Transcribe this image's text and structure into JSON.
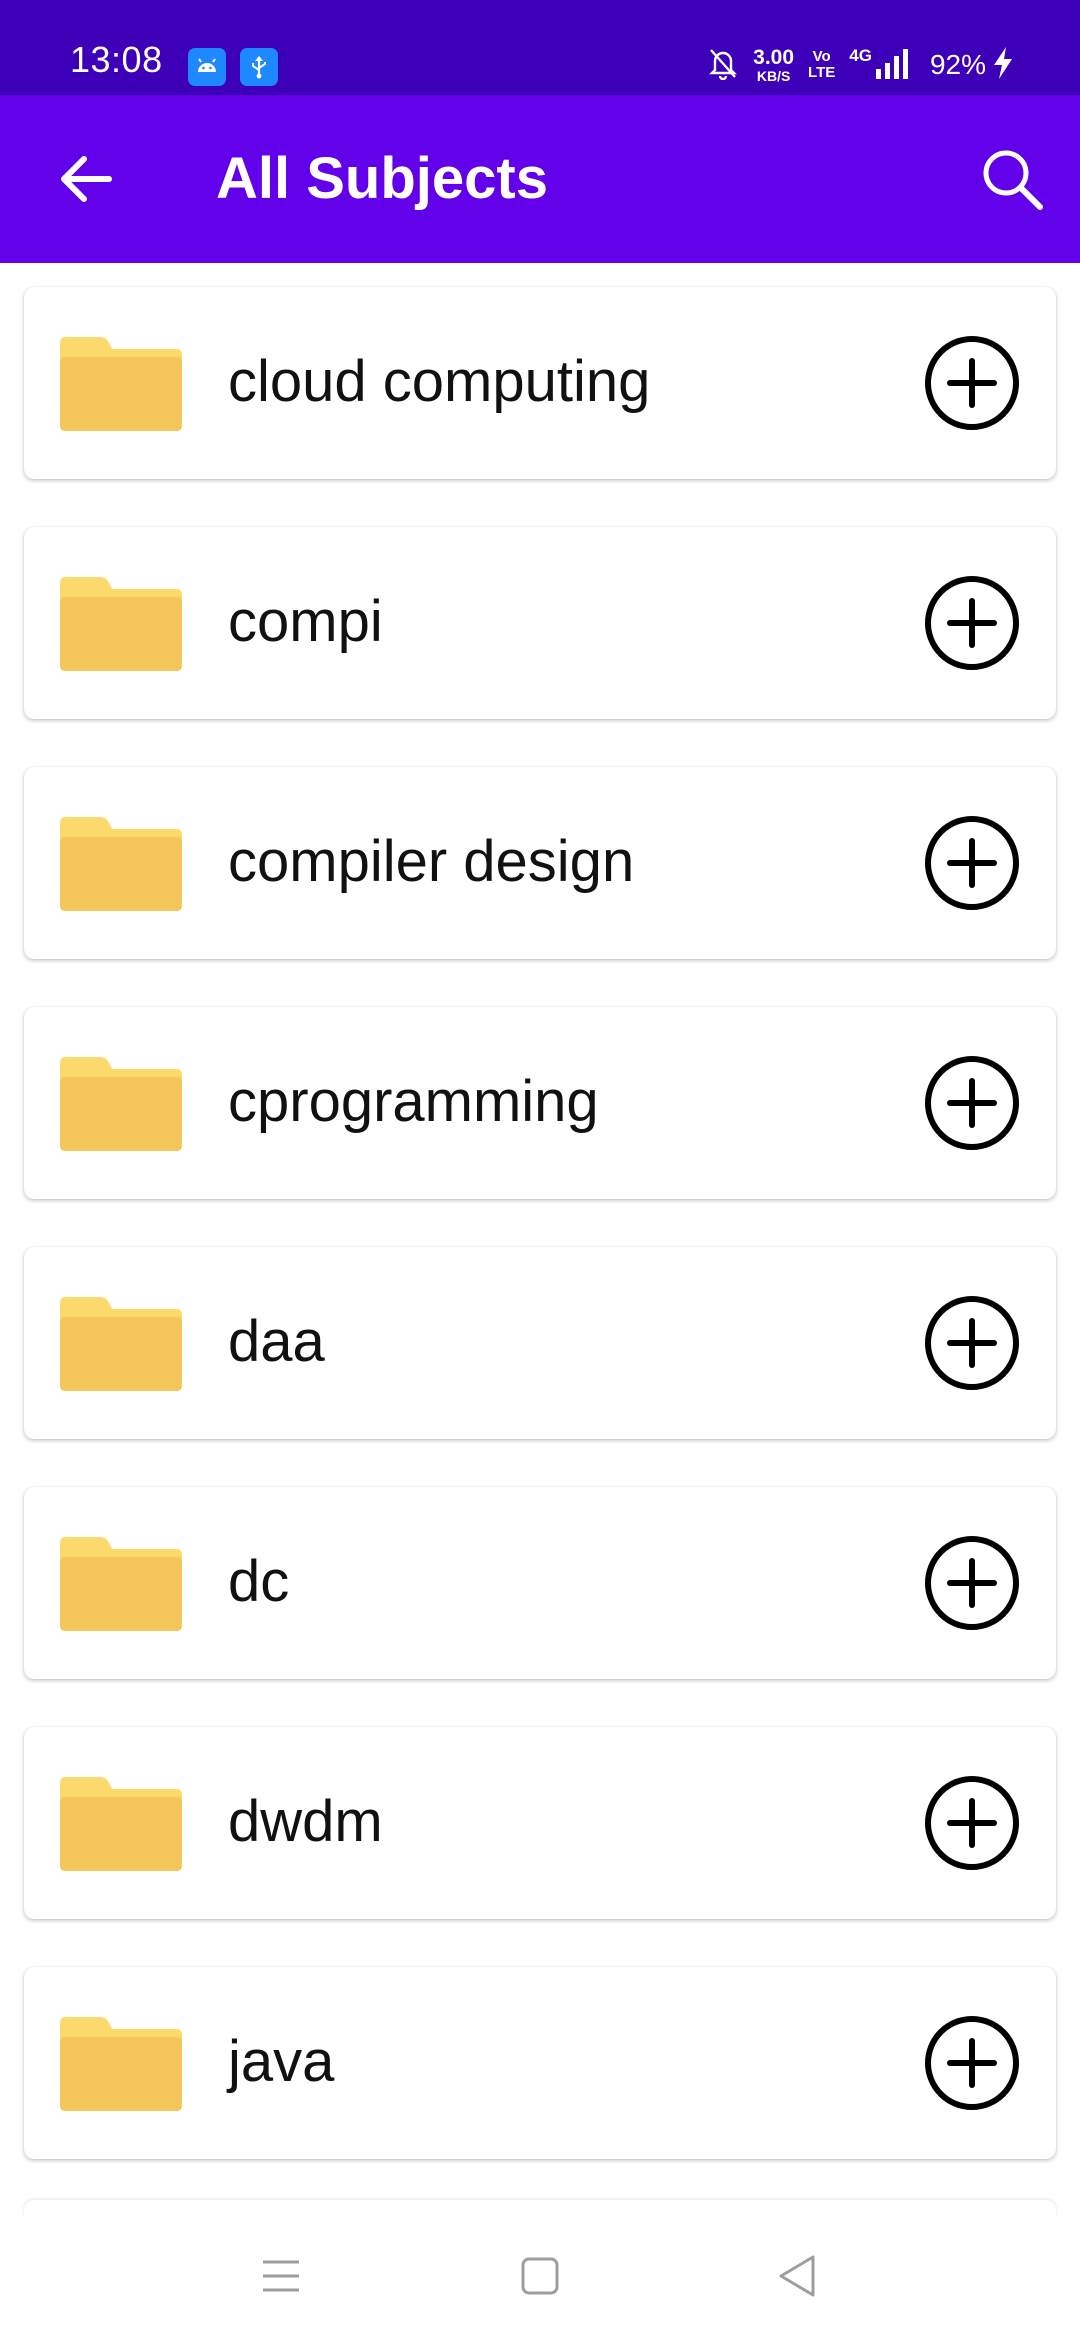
{
  "status_bar": {
    "time": "13:08",
    "notification_icons": [
      "android-debug-icon",
      "usb-icon"
    ],
    "mute_icon": "bell-off-icon",
    "net_speed_value": "3.00",
    "net_speed_unit": "KB/S",
    "volte_top": "Vo",
    "volte_bottom": "LTE",
    "network_type": "4G",
    "signal_icon": "signal-bars-icon",
    "battery_percent": "92%",
    "charging_icon": "bolt-icon",
    "background_color": "#3d00b8"
  },
  "app_bar": {
    "title": "All Subjects",
    "back_icon": "arrow-left-icon",
    "search_icon": "search-icon",
    "background_color": "#6200ea"
  },
  "subjects": [
    {
      "name": "cloud computing"
    },
    {
      "name": "compi"
    },
    {
      "name": "compiler design"
    },
    {
      "name": "cprogramming"
    },
    {
      "name": "daa"
    },
    {
      "name": "dc"
    },
    {
      "name": "dwdm"
    },
    {
      "name": "java"
    }
  ],
  "list_item_icons": {
    "folder_icon": "folder-icon",
    "add_icon": "plus-circle-icon",
    "folder_color": "#f8c65a"
  },
  "nav_bar": {
    "menu_icon": "menu-icon",
    "home_icon": "square-home-icon",
    "back_icon": "triangle-back-icon"
  }
}
